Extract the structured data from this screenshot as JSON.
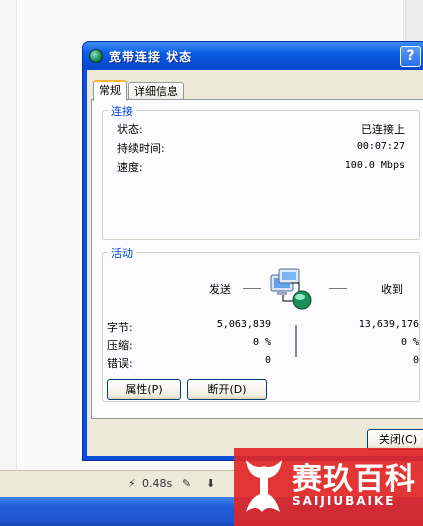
{
  "window": {
    "title": "宽带连接 状态",
    "help_label": "?"
  },
  "tabs": [
    {
      "label": "常规",
      "active": true
    },
    {
      "label": "详细信息",
      "active": false
    }
  ],
  "connection": {
    "group_title": "连接",
    "rows": [
      {
        "label": "状态:",
        "value": "已连接上"
      },
      {
        "label": "持续时间:",
        "value": "00:07:27"
      },
      {
        "label": "速度:",
        "value": "100.0 Mbps"
      }
    ]
  },
  "activity": {
    "group_title": "活动",
    "sent_label": "发送",
    "received_label": "收到",
    "rows": [
      {
        "label": "字节:",
        "sent": "5,063,839",
        "received": "13,639,176"
      },
      {
        "label": "压缩:",
        "sent": "0 %",
        "received": "0 %"
      },
      {
        "label": "错误:",
        "sent": "0",
        "received": "0"
      }
    ]
  },
  "buttons": {
    "properties": "属性(P)",
    "disconnect": "断开(D)",
    "close": "关闭(C)"
  },
  "statusbar": {
    "timing": "0.48s"
  },
  "watermark": {
    "brand_cn": "赛玖百科",
    "brand_en": "SAIJIUBAIKE"
  },
  "colors": {
    "titlebar": "#0a4fd8",
    "group_title": "#0046d5",
    "tab_highlight": "#f8b73a",
    "watermark": "#e02626"
  }
}
